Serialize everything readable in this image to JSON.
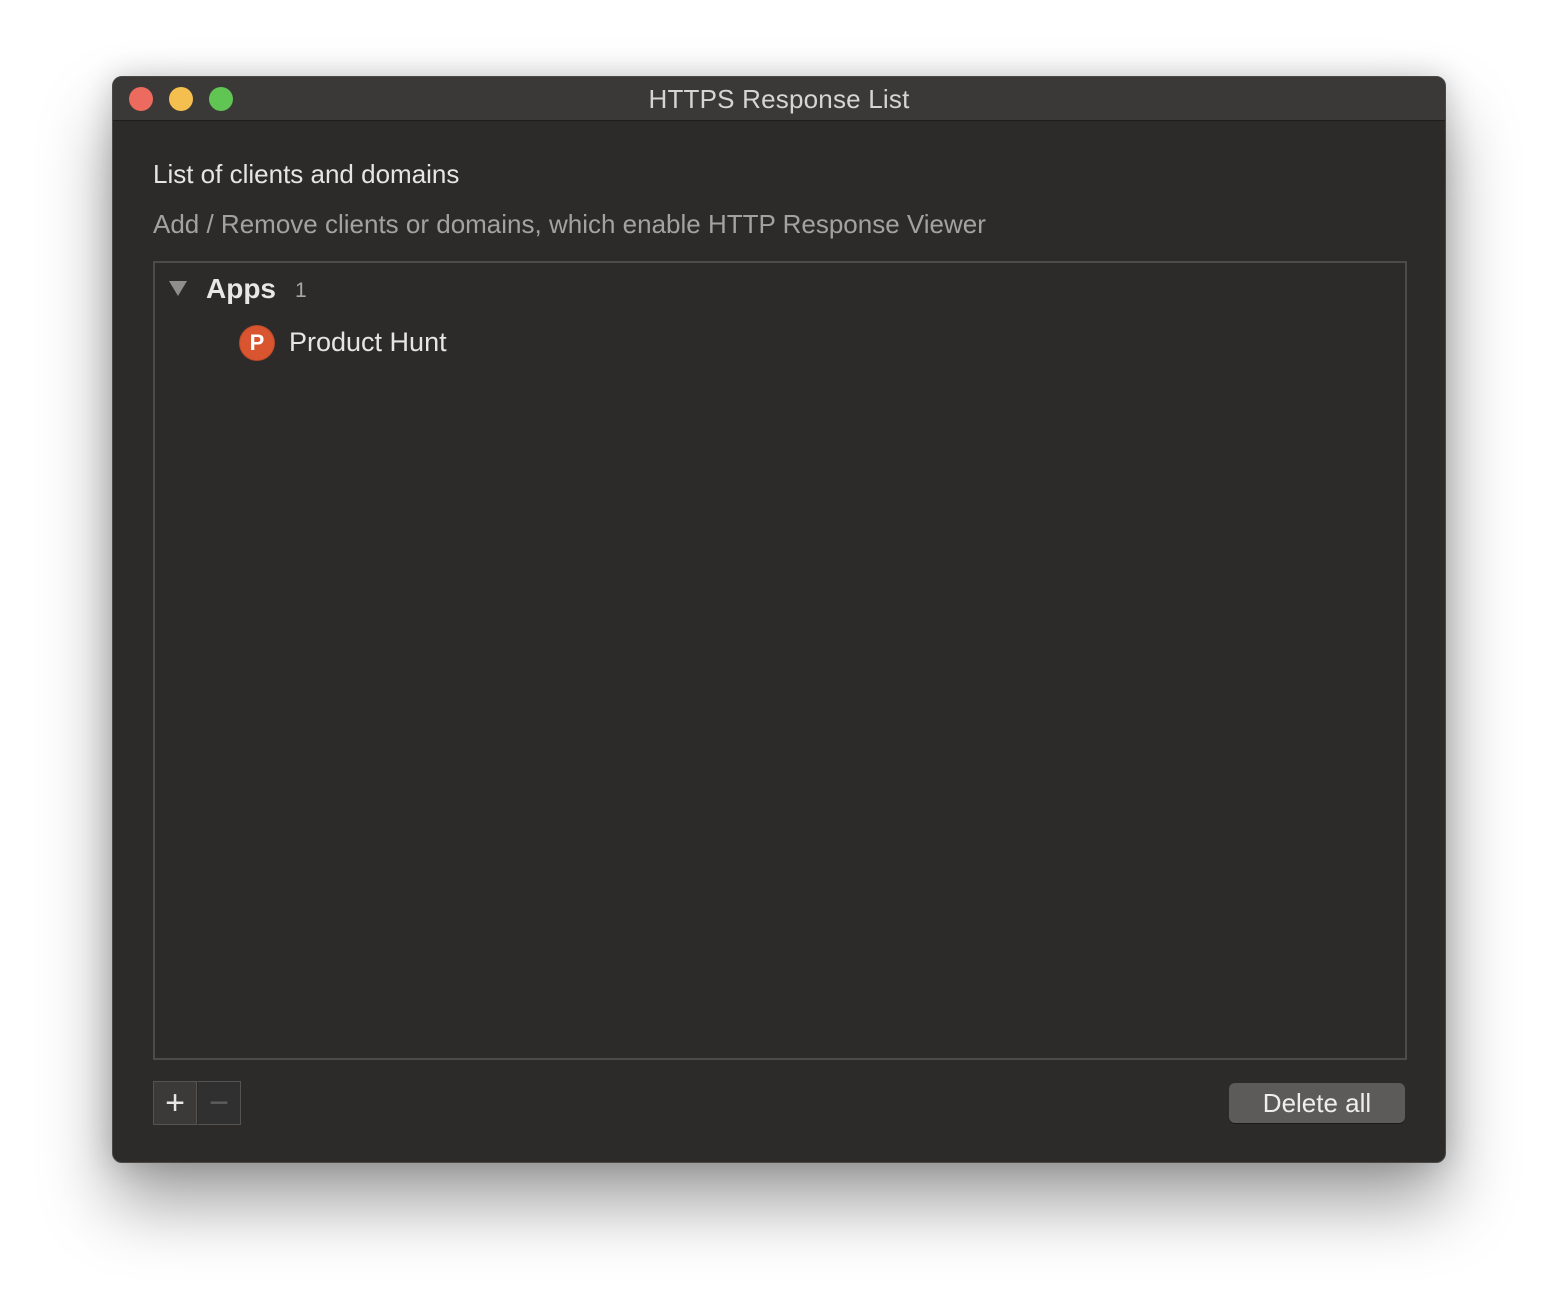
{
  "window": {
    "title": "HTTPS Response List",
    "traffic_lights": {
      "close_color": "#ed6a5e",
      "minimize_color": "#f5bf4f",
      "zoom_color": "#61c554"
    }
  },
  "header": {
    "title": "List of clients and domains",
    "subtitle": "Add / Remove clients or domains, which enable HTTP Response Viewer"
  },
  "list": {
    "groups": [
      {
        "label": "Apps",
        "count": "1",
        "expanded": true,
        "items": [
          {
            "label": "Product Hunt",
            "icon": "product-hunt-icon",
            "icon_letter": "P",
            "icon_color": "#d9552f"
          }
        ]
      }
    ]
  },
  "toolbar": {
    "add_glyph": "+",
    "remove_glyph": "−",
    "delete_all_label": "Delete all"
  }
}
